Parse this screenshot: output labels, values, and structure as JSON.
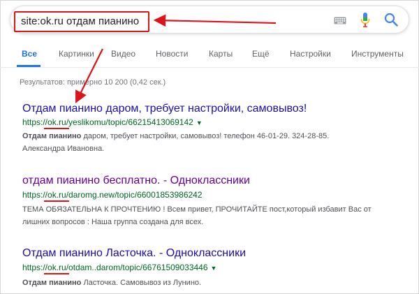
{
  "search": {
    "query": "site:ok.ru отдам пианино"
  },
  "tabs": [
    {
      "label": "Все"
    },
    {
      "label": "Картинки"
    },
    {
      "label": "Видео"
    },
    {
      "label": "Новости"
    },
    {
      "label": "Карты"
    },
    {
      "label": "Ещё"
    },
    {
      "label": "Настройки"
    },
    {
      "label": "Инструменты"
    }
  ],
  "stats": "Результатов: примерно 10 200 (0,42 сек.)",
  "results": [
    {
      "title": "Отдам пианино даром, требует настройки, самовывоз!",
      "url": "https://ok.ru/yeslikomu/topic/66215413069142",
      "snippet_bold": "Отдам пианино",
      "snippet_line1": " даром, требует настройки, самовывоз! телефон 46-01-29. 324-28-85.",
      "snippet_line2": "Александра Ивановна."
    },
    {
      "title": "отдам пианино бесплатно. - Одноклассники",
      "url": "https://ok.ru/daromg.new/topic/66001853986242",
      "snippet_line1": "ТЕМА ОБЯЗАТЕЛЬНА К ПРОЧТЕНИЮ ! Всем привет, ПРОЧИТАЙТЕ пост,который избавит Вас от",
      "snippet_line2": "лишних вопросов : Наша группа создана для всех."
    },
    {
      "title": "Отдам пианино Ласточка. - Одноклассники",
      "url": "https://ok.ru/otdam..darom/topic/66761509033446",
      "snippet_bold": "Отдам пианино",
      "snippet_line1": " Ласточка. Самовывоз из Лунино."
    }
  ],
  "colors": {
    "annotation_red": "#e0131a",
    "link_blue": "#1a0dab",
    "visited_purple": "#660099",
    "url_green": "#006621",
    "active_tab_blue": "#1a73e8"
  }
}
